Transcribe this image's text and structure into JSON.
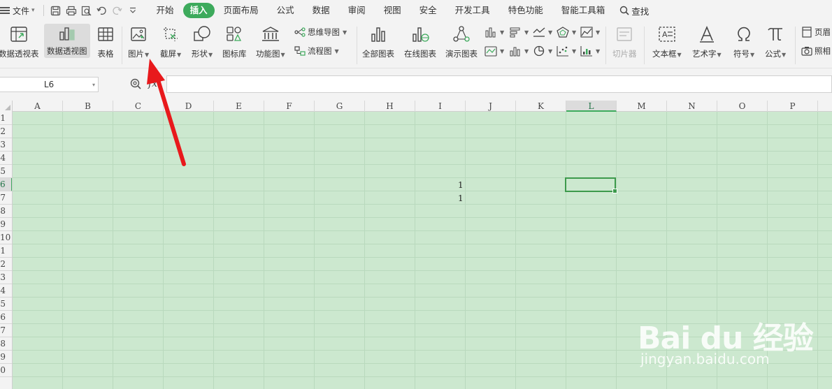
{
  "menubar": {
    "file_label": "文件",
    "tabs": [
      "开始",
      "插入",
      "页面布局",
      "公式",
      "数据",
      "审阅",
      "视图",
      "安全",
      "开发工具",
      "特色功能",
      "智能工具箱"
    ],
    "active_tab": "插入",
    "find_label": "查找"
  },
  "ribbon": {
    "pivot_table": "数据透视表",
    "pivot_chart": "数据透视图",
    "table": "表格",
    "picture": "图片",
    "screenshot": "截屏",
    "shapes": "形状",
    "icon_library": "图标库",
    "function_chart": "功能图",
    "mind_map": "思维导图",
    "flowchart": "流程图",
    "all_charts": "全部图表",
    "online_charts": "在线图表",
    "demo_charts": "演示图表",
    "slicer": "切片器",
    "text_box": "文本框",
    "word_art": "艺术字",
    "symbol": "符号",
    "formula": "公式",
    "header_footer": "页眉",
    "camera": "照相"
  },
  "formula_bar": {
    "name_box": "L6",
    "fx": "fx",
    "value": ""
  },
  "grid": {
    "columns": [
      "A",
      "B",
      "C",
      "D",
      "E",
      "F",
      "G",
      "H",
      "I",
      "J",
      "K",
      "L",
      "M",
      "N",
      "O",
      "P"
    ],
    "selected_column": "L",
    "row_labels": [
      "1",
      "2",
      "3",
      "4",
      "5",
      "6",
      "7",
      "8",
      "9",
      "10",
      "1",
      "2",
      "3",
      "4",
      "5",
      "6",
      "7",
      "8",
      "9",
      "0"
    ],
    "selected_row": "6",
    "cells": [
      {
        "ref": "J6",
        "value": "1"
      },
      {
        "ref": "J7",
        "value": "1"
      }
    ]
  },
  "watermark": {
    "brand": "Bai du 经验",
    "url": "jingyan.baidu.com"
  },
  "colors": {
    "accent": "#3daa5c",
    "sheet_background": "#cce8cf",
    "arrow": "#e8191c"
  }
}
